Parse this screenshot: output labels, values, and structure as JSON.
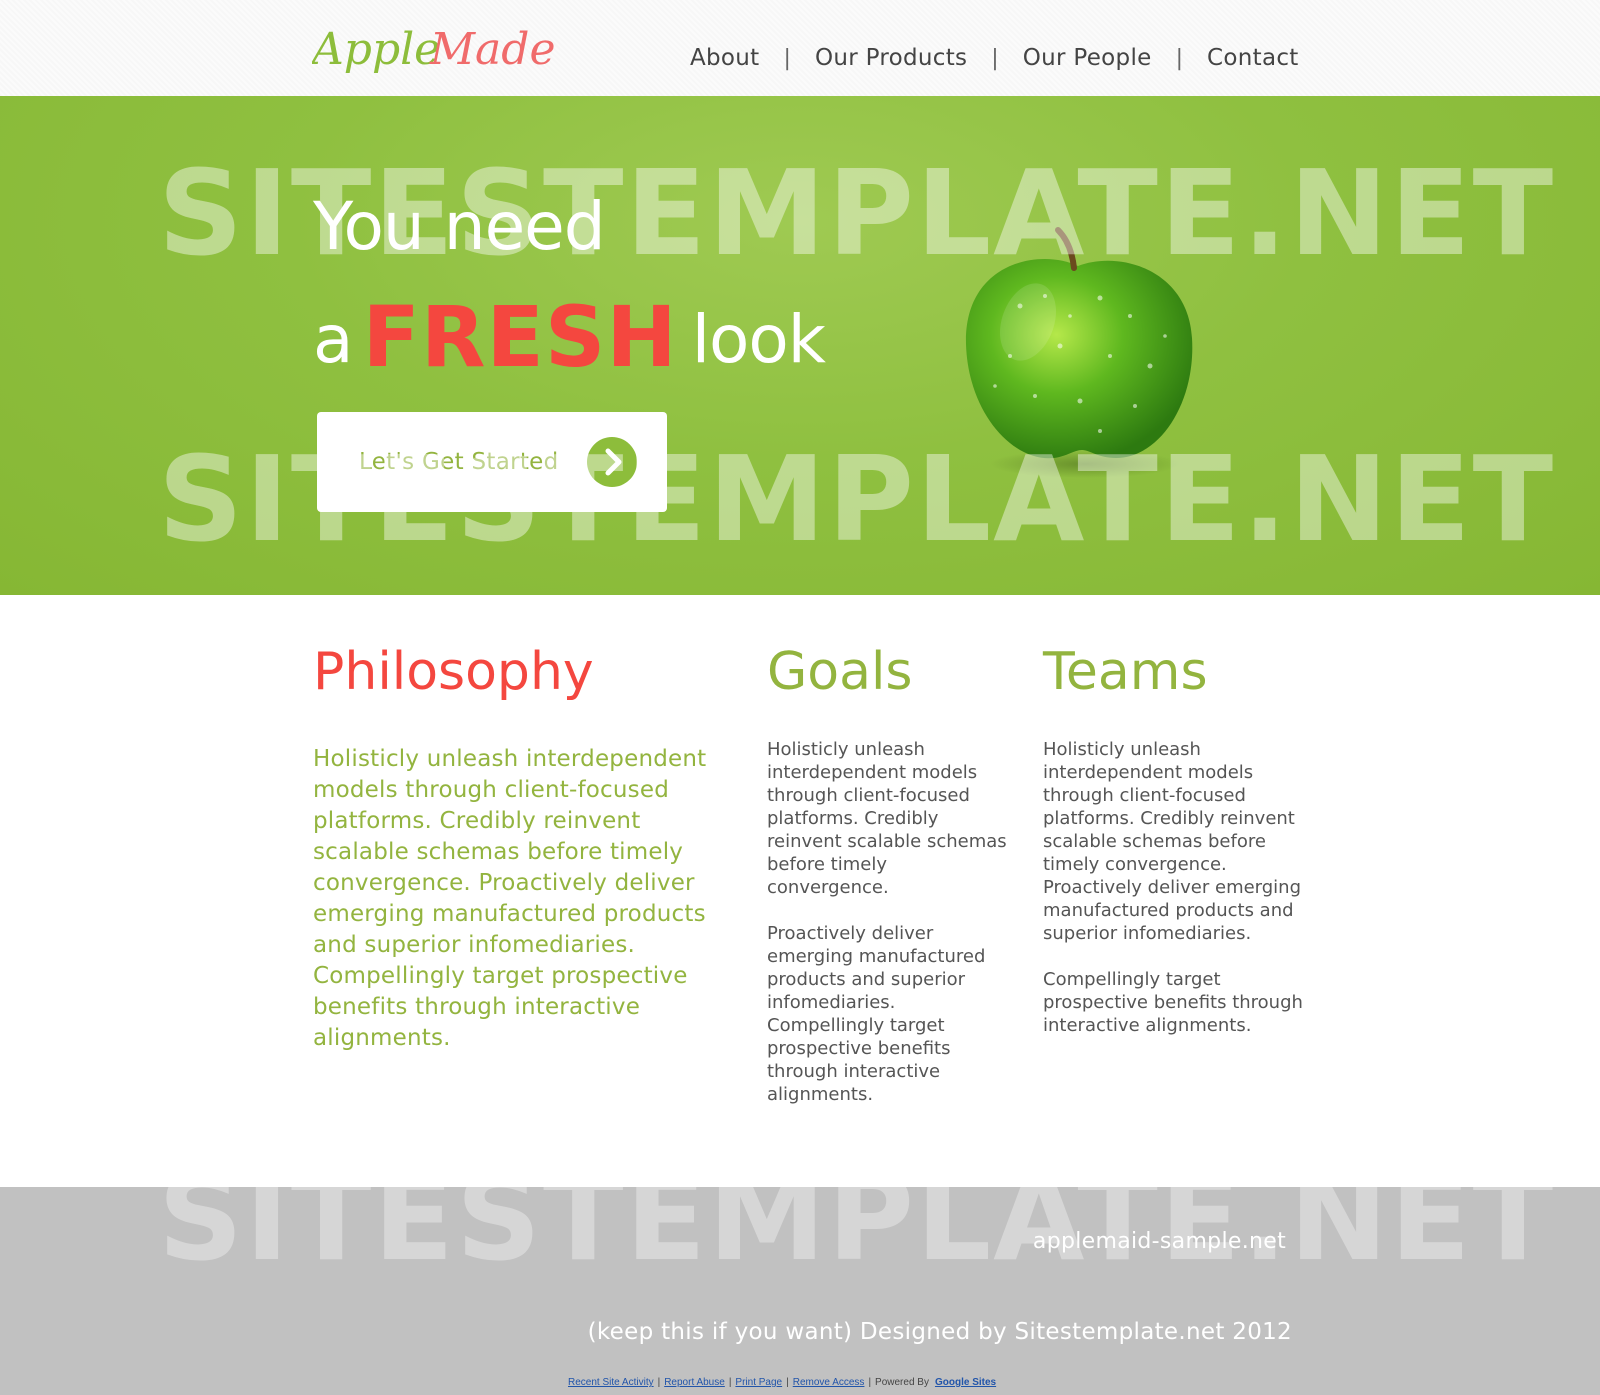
{
  "header": {
    "logo_text": "AppleMade",
    "nav": [
      {
        "label": "About"
      },
      {
        "label": "Our Products"
      },
      {
        "label": "Our People"
      },
      {
        "label": "Contact"
      }
    ],
    "nav_separator": "|"
  },
  "hero": {
    "line1": "You need",
    "line2_prefix": "a",
    "line2_highlight": "FRESH",
    "line2_suffix": "look",
    "cta_label": "Let's Get Started"
  },
  "watermark": "SITESTEMPLATE.NET",
  "content": {
    "philosophy": {
      "title": "Philosophy",
      "text": "Holisticly unleash interdependent models through client-focused platforms. Credibly reinvent scalable schemas before timely convergence. Proactively deliver emerging manufactured products and superior infomediaries. Compellingly target prospective benefits through interactive alignments."
    },
    "goals": {
      "title": "Goals",
      "p1": "Holisticly unleash interdependent models through client-focused platforms. Credibly reinvent scalable schemas before timely convergence.",
      "p2": "Proactively deliver emerging manufactured products and superior infomediaries. Compellingly target prospective benefits through interactive alignments."
    },
    "teams": {
      "title": "Teams",
      "p1": "Holisticly unleash interdependent models through client-focused platforms. Credibly reinvent scalable schemas before timely convergence. Proactively deliver emerging manufactured products and superior infomediaries.",
      "p2": "Compellingly target prospective benefits through interactive alignments."
    }
  },
  "footer": {
    "site": "applemaid-sample.net",
    "credit": "(keep this if you want) Designed by Sitestemplate.net 2012",
    "links": [
      "Recent Site Activity",
      "Report Abuse",
      "Print Page",
      "Remove Access"
    ],
    "powered_by": "Powered By",
    "google_sites": "Google Sites"
  },
  "colors": {
    "accent_green": "#8dbd3b",
    "accent_red": "#f4473f",
    "footer_gray": "#c1c1c1"
  },
  "icons": [
    "chevron-right-icon",
    "apple-image"
  ]
}
